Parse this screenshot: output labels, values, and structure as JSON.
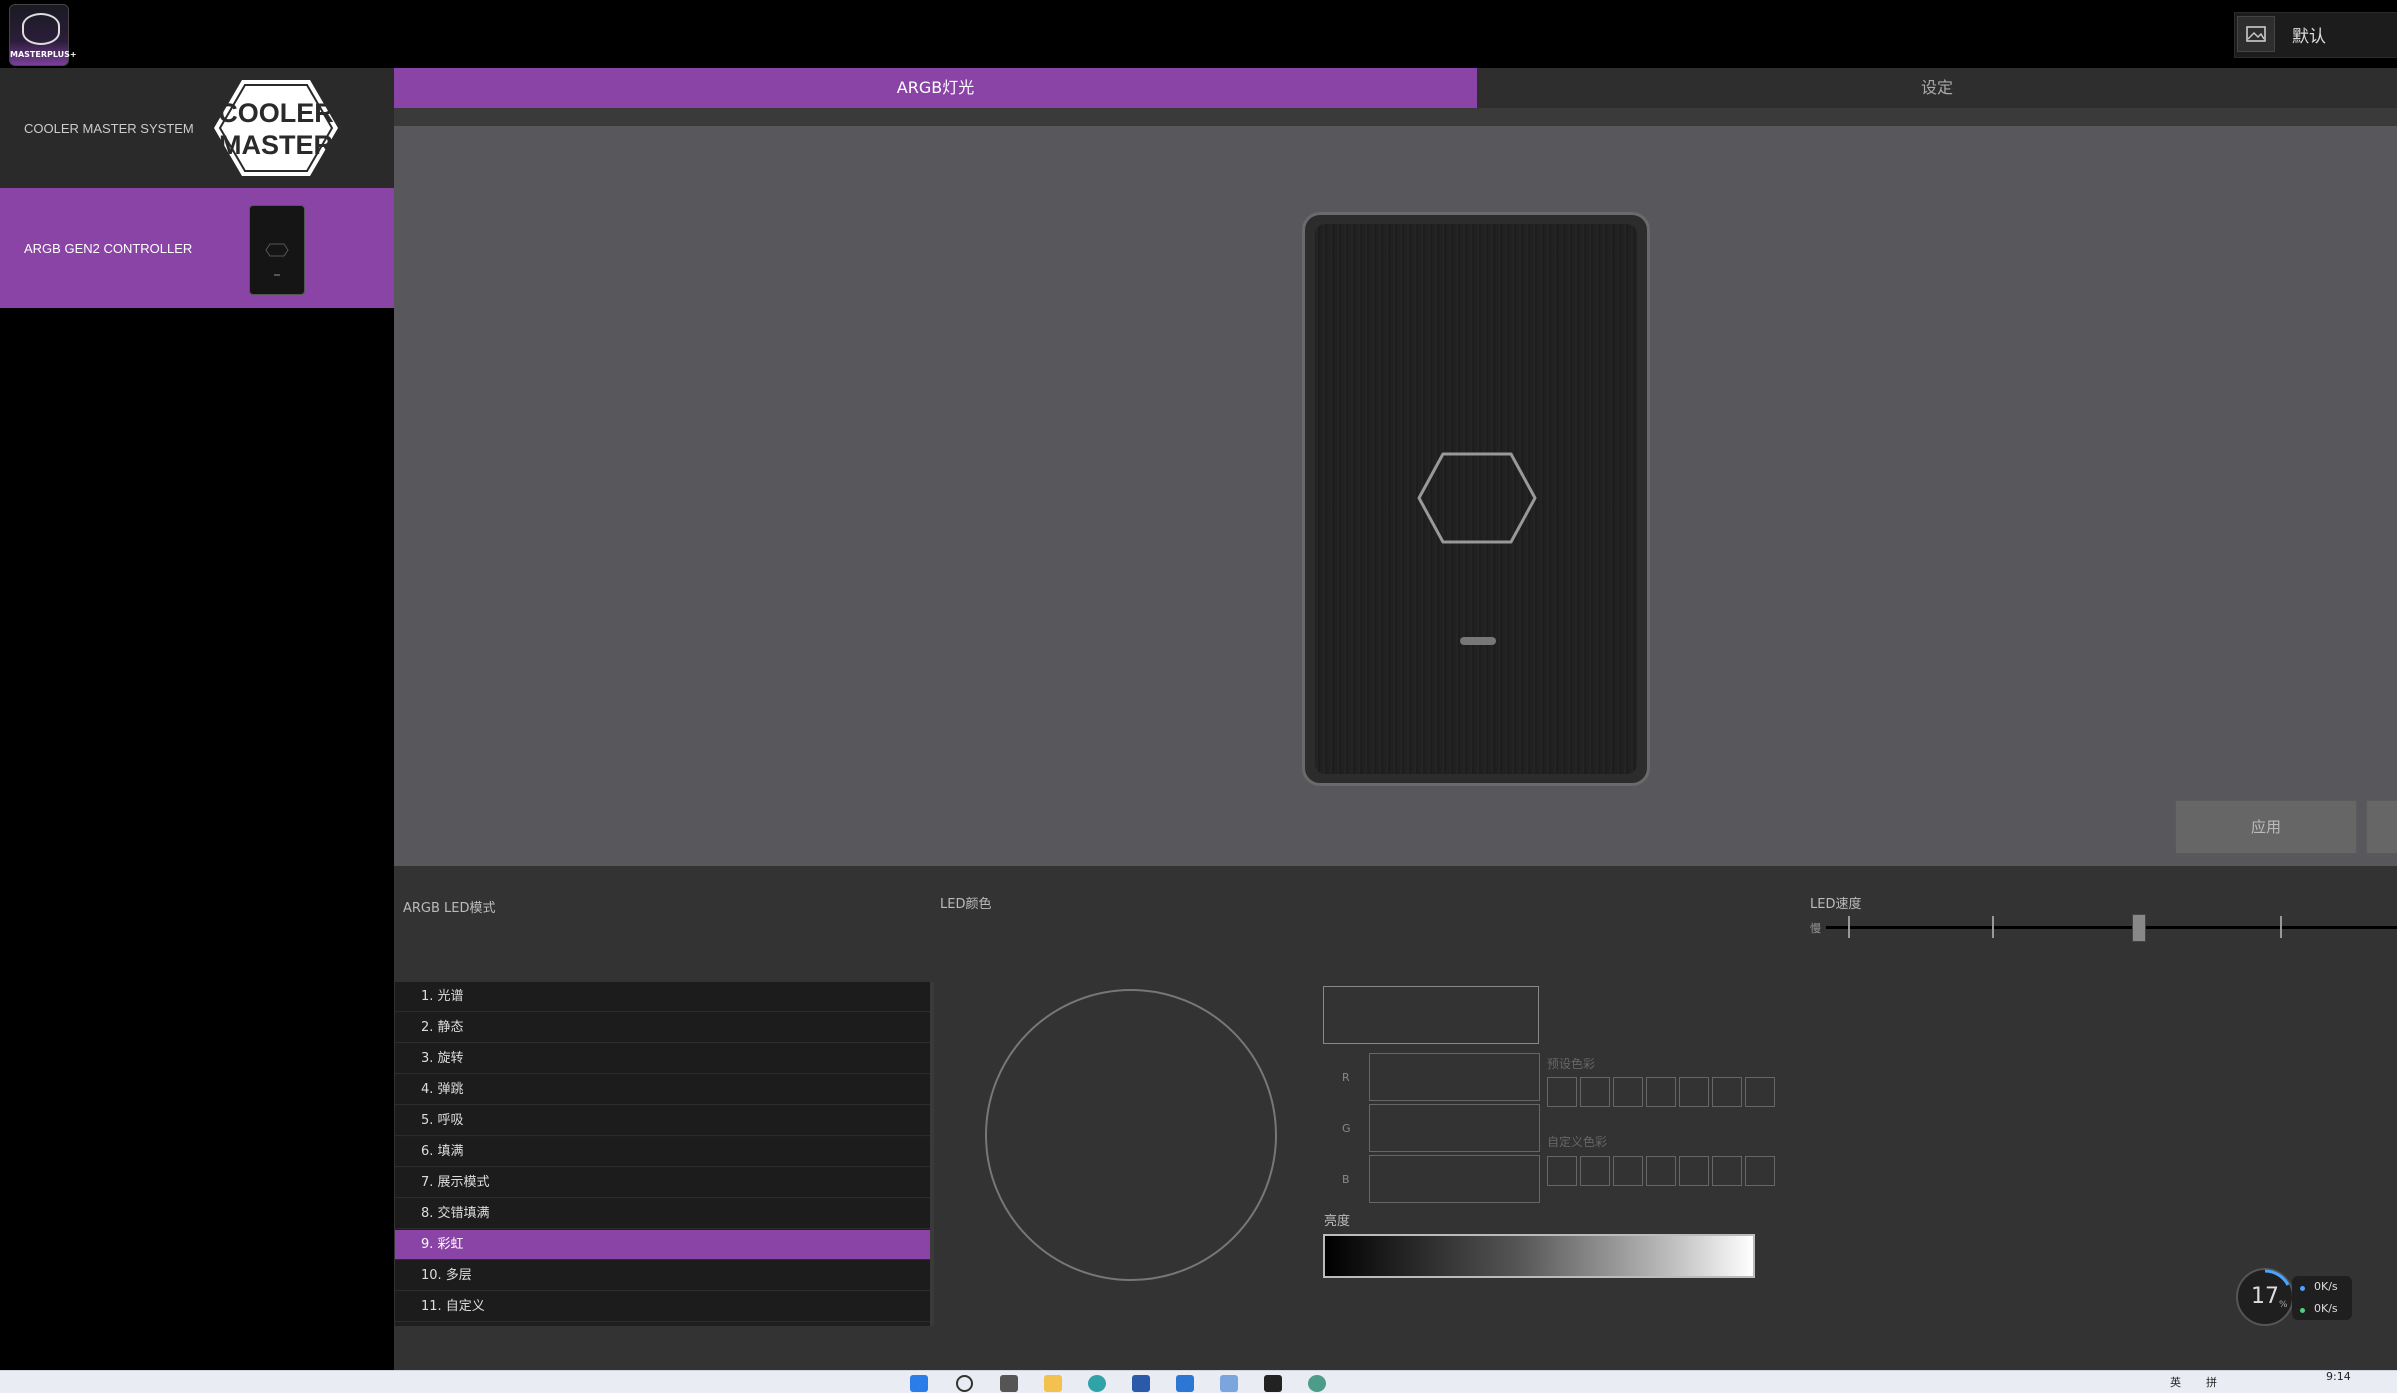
{
  "app": {
    "logo_text": "MASTERPLUS+",
    "profile_label": "默认"
  },
  "sidebar": {
    "items": [
      {
        "label": "COOLER MASTER SYSTEM",
        "logo_text": "COOLER MASTER"
      },
      {
        "label": "ARGB GEN2 CONTROLLER",
        "selected": true
      }
    ]
  },
  "tabs": [
    {
      "label": "ARGB灯光",
      "active": true
    },
    {
      "label": "设定",
      "active": false
    }
  ],
  "preview": {
    "apply_label": "应用"
  },
  "panel": {
    "mode_title": "ARGB LED模式",
    "color_title": "LED颜色",
    "speed_title": "LED速度",
    "speed_slow_label": "慢",
    "speed_level": 3,
    "speed_levels": 5,
    "modes": [
      "1. 光谱",
      "2. 静态",
      "3. 旋转",
      "4. 弹跳",
      "5. 呼吸",
      "6. 填满",
      "7. 展示模式",
      "8. 交错填满",
      "9. 彩虹",
      "10. 多层",
      "11. 自定义"
    ],
    "selected_mode": "9. 彩虹",
    "rgb_labels": [
      "R",
      "G",
      "B"
    ],
    "preset_colors_label": "预设色彩",
    "custom_colors_label": "自定义色彩",
    "brightness_label": "亮度",
    "brightness_level": 1.0
  },
  "widget": {
    "cpu_value": "17",
    "cpu_unit": "%",
    "net_up": "0K/s",
    "net_down": "0K/s"
  },
  "taskbar": {
    "time": "9:14",
    "lang": "英",
    "ime": "拼"
  },
  "colors": {
    "accent": "#8a44a6",
    "panel": "#333333",
    "preview_bg": "#57575c"
  }
}
